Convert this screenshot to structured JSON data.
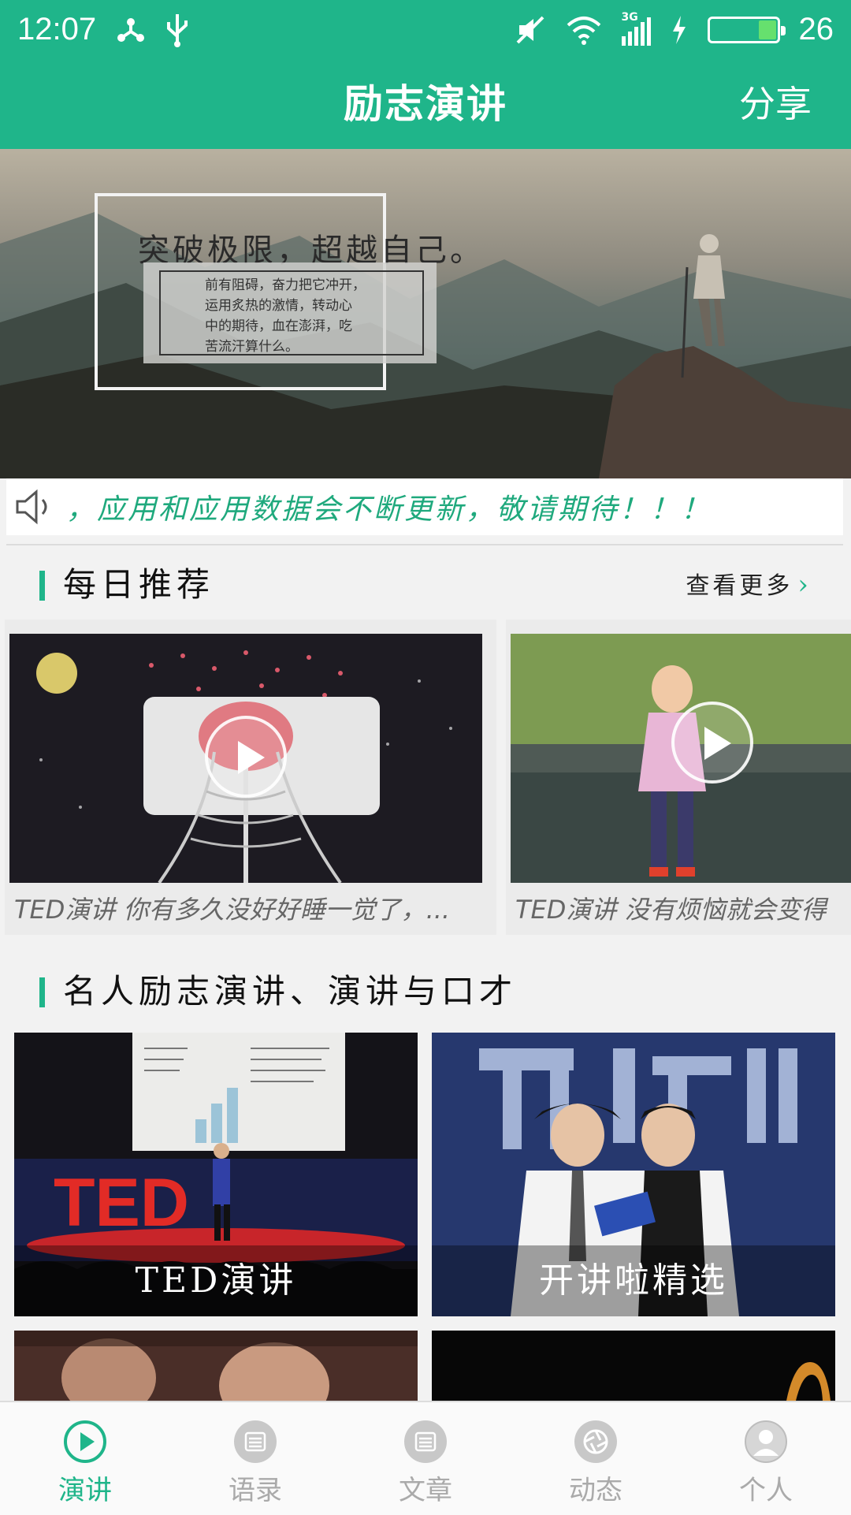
{
  "status_bar": {
    "time": "12:07",
    "network": "3G",
    "battery_level": "26",
    "icons": [
      "network-share-icon",
      "usb-icon",
      "mute-icon",
      "wifi-icon",
      "signal-icon",
      "charging-icon",
      "battery-icon"
    ]
  },
  "app_bar": {
    "title": "励志演讲",
    "share_label": "分享"
  },
  "banner": {
    "headline": "突破极限，超越自己。",
    "body_lines": [
      "前有阻碍，奋力把它冲开，",
      "运用炙热的激情，转动心",
      "中的期待，血在澎湃，吃",
      "苦流汗算什么。"
    ]
  },
  "notice": {
    "icon": "speaker-icon",
    "text": "，应用和应用数据会不断更新，敬请期待！！！"
  },
  "daily": {
    "title": "每日推荐",
    "more_label": "查看更多",
    "items": [
      {
        "caption": "TED演讲 你有多久没好好睡一觉了，..."
      },
      {
        "caption": "TED演讲 没有烦恼就会变得"
      }
    ]
  },
  "categories": {
    "title": "名人励志演讲、演讲与口才",
    "items": [
      {
        "label": "TED演讲"
      },
      {
        "label": "开讲啦精选"
      },
      {
        "label": ""
      },
      {
        "label": ""
      }
    ]
  },
  "bottom_nav": {
    "items": [
      {
        "label": "演讲",
        "icon": "play-circle-icon",
        "active": true
      },
      {
        "label": "语录",
        "icon": "list-circle-icon",
        "active": false
      },
      {
        "label": "文章",
        "icon": "list-circle-icon",
        "active": false
      },
      {
        "label": "动态",
        "icon": "camera-shutter-icon",
        "active": false
      },
      {
        "label": "个人",
        "icon": "person-icon",
        "active": false
      }
    ]
  },
  "colors": {
    "accent": "#1fb58a",
    "nav_inactive": "#aaaaaa"
  }
}
